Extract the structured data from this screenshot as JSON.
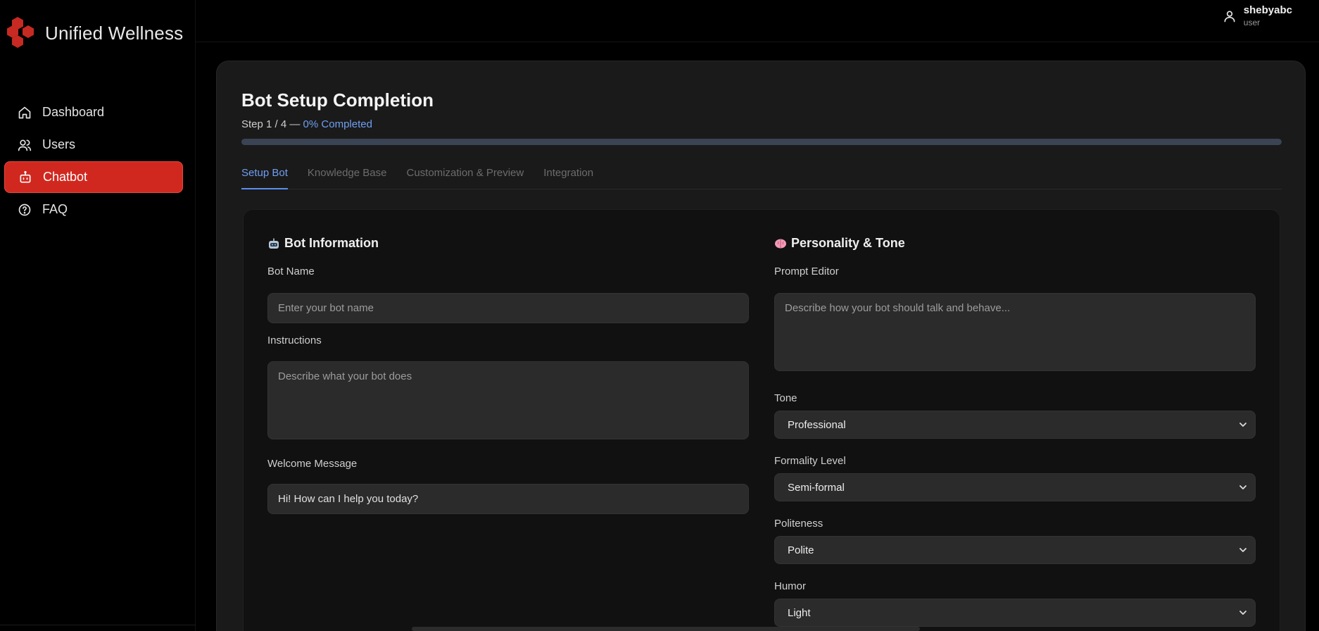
{
  "app": {
    "name": "Unified Wellness"
  },
  "colors": {
    "accent_red": "#d0281f",
    "accent_blue": "#5b8ef0",
    "card_bg": "#1a1a1a"
  },
  "sidebar": {
    "items": [
      {
        "label": "Dashboard",
        "icon": "home-icon",
        "active": false
      },
      {
        "label": "Users",
        "icon": "users-icon",
        "active": false
      },
      {
        "label": "Chatbot",
        "icon": "bot-icon",
        "active": true
      },
      {
        "label": "FAQ",
        "icon": "help-circle-icon",
        "active": false
      }
    ]
  },
  "user": {
    "name": "shebyabc",
    "role": "user",
    "icon": "user-icon"
  },
  "setup": {
    "title": "Bot Setup Completion",
    "step_text": "Step 1 / 4 — ",
    "percent_text": "0% Completed",
    "progress_fraction": 0
  },
  "tabs": [
    {
      "label": "Setup Bot",
      "active": true
    },
    {
      "label": "Knowledge Base",
      "active": false
    },
    {
      "label": "Customization & Preview",
      "active": false
    },
    {
      "label": "Integration",
      "active": false
    }
  ],
  "bot_info": {
    "title": "Bot Information",
    "icon": "robot-emoji-icon",
    "bot_name": {
      "label": "Bot Name",
      "placeholder": "Enter your bot name",
      "value": ""
    },
    "instructions": {
      "label": "Instructions",
      "placeholder": "Describe what your bot does",
      "value": ""
    },
    "welcome": {
      "label": "Welcome Message",
      "placeholder": "",
      "value": "Hi! How can I help you today?"
    }
  },
  "personality": {
    "title": "Personality & Tone",
    "icon": "brain-emoji-icon",
    "prompt": {
      "label": "Prompt Editor",
      "placeholder": "Describe how your bot should talk and behave...",
      "value": ""
    },
    "tone": {
      "label": "Tone",
      "value": "Professional"
    },
    "formality": {
      "label": "Formality Level",
      "value": "Semi-formal"
    },
    "politeness": {
      "label": "Politeness",
      "value": "Polite"
    },
    "humor": {
      "label": "Humor",
      "value": "Light"
    }
  }
}
